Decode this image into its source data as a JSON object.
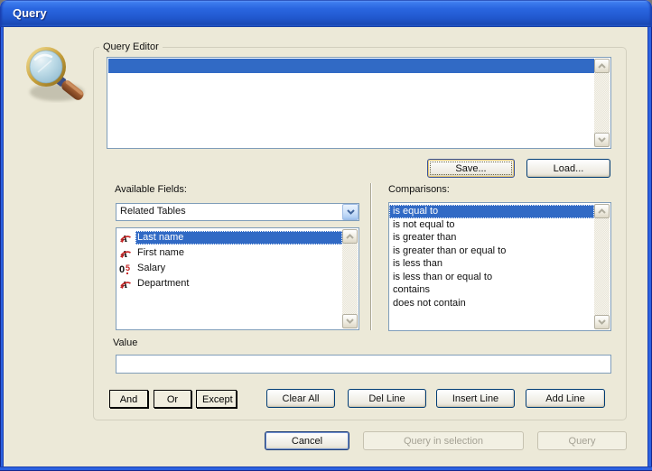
{
  "window": {
    "title": "Query"
  },
  "colors": {
    "dialog_bg": "#ECE9D8",
    "selection_blue": "#316AC5",
    "titlebar_blue": "#2A66E0",
    "control_border": "#7F9DB9",
    "button_border": "#003C74"
  },
  "icons": {
    "dialog_icon": "magnifying-glass",
    "text_field_icon": "italic-A-with-red-arrow",
    "number_field_icon": "05-digits",
    "combo_icon": "chevron-down",
    "scroll_up_icon": "chevron-up",
    "scroll_down_icon": "chevron-down"
  },
  "query_editor": {
    "group_label": "Query Editor",
    "rows": [
      {
        "text": "",
        "selected": true
      }
    ],
    "save_label": "Save...",
    "load_label": "Load..."
  },
  "available_fields": {
    "label": "Available Fields:",
    "dropdown_value": "Related Tables",
    "items": [
      {
        "icon": "text-field",
        "label": "Last name",
        "selected": true
      },
      {
        "icon": "text-field",
        "label": "First name",
        "selected": false
      },
      {
        "icon": "number-field",
        "label": "Salary",
        "selected": false
      },
      {
        "icon": "text-field",
        "label": "Department",
        "selected": false
      }
    ]
  },
  "comparisons": {
    "label": "Comparisons:",
    "selected_index": 0,
    "items": [
      "is equal to",
      "is not equal to",
      "is greater than",
      "is greater than or equal to",
      "is less than",
      "is less than or equal to",
      "contains",
      "does not contain"
    ]
  },
  "value_field": {
    "label": "Value",
    "value": ""
  },
  "operator_buttons": {
    "and": "And",
    "or": "Or",
    "except": "Except"
  },
  "line_buttons": {
    "clear_all": "Clear All",
    "del_line": "Del Line",
    "insert_line": "Insert Line",
    "add_line": "Add Line"
  },
  "footer_buttons": {
    "cancel": "Cancel",
    "query_in_selection": "Query in selection",
    "query": "Query",
    "query_in_selection_enabled": false,
    "query_enabled": false
  }
}
